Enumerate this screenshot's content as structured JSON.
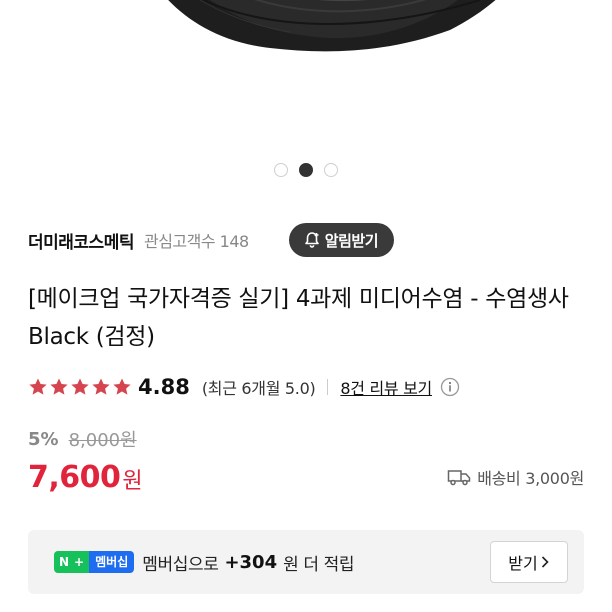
{
  "carousel": {
    "count": 3,
    "active_index": 1
  },
  "seller": {
    "name": "더미래코스메틱",
    "followers_label": "관심고객수 148",
    "follow_button": "알림받기"
  },
  "product": {
    "title": "[메이크업 국가자격증 실기] 4과제 미디어수염 - 수염생사 Black (검정)"
  },
  "rating": {
    "stars": 5,
    "value": "4.88",
    "recent": "(최근 6개월 5.0)",
    "reviews_link": "8건 리뷰 보기"
  },
  "price": {
    "discount": "5%",
    "original": "8,000원",
    "final": "7,600",
    "unit": "원",
    "shipping": "배송비 3,000원"
  },
  "membership": {
    "badge_n": "N",
    "badge_plus": "+",
    "badge_label": "멤버십",
    "text": "멤버십으로",
    "amount": "+304",
    "suffix": "원 더 적립",
    "button": "받기"
  },
  "colors": {
    "price": "#e0243b",
    "star": "#d5454f",
    "badge_green": "#16c05a",
    "badge_blue": "#1e6cf0"
  }
}
